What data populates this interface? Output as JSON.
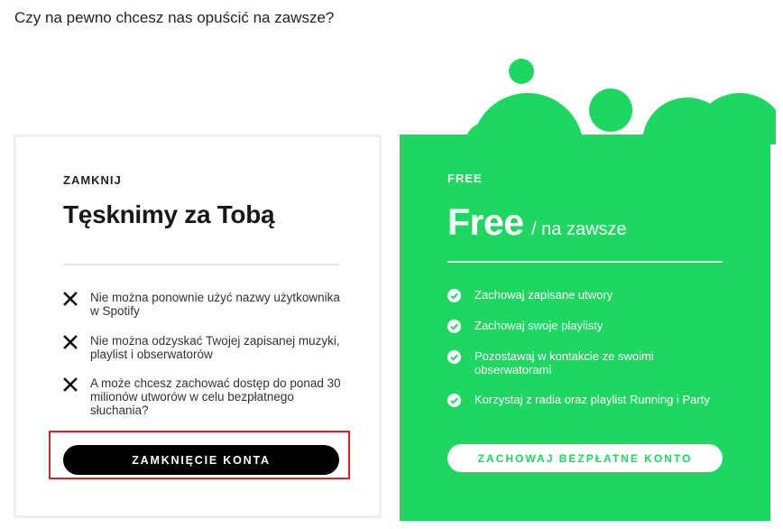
{
  "page": {
    "question": "Czy na pewno chcesz nas opuścić na zawsze?"
  },
  "close_card": {
    "kicker": "ZAMKNIJ",
    "heading": "Tęsknimy za Tobą",
    "items": [
      {
        "icon": "x-icon",
        "text": "Nie można ponownie użyć nazwy użytkownika w Spotify"
      },
      {
        "icon": "x-icon",
        "text": "Nie można odzyskać Twojej zapisanej muzyki, playlist i obserwatorów"
      },
      {
        "icon": "x-icon",
        "text": "A może chcesz zachować dostęp do ponad 30 milionów utworów w celu bezpłatnego słuchania?"
      }
    ],
    "button_label": "ZAMKNIĘCIE KONTA"
  },
  "free_card": {
    "kicker": "FREE",
    "plan_name": "Free",
    "plan_suffix": "/ na zawsze",
    "items": [
      {
        "icon": "check-circle-icon",
        "text": "Zachowaj zapisane utwory"
      },
      {
        "icon": "check-circle-icon",
        "text": "Zachowaj swoje playlisty"
      },
      {
        "icon": "check-circle-icon",
        "text": "Pozostawaj w kontakcie ze swoimi obserwatorami"
      },
      {
        "icon": "check-circle-icon",
        "text": "Korzystaj z radia oraz playlist Running i Party"
      }
    ],
    "button_label": "ZACHOWAJ BEZPŁATNE KONTO"
  },
  "colors": {
    "brand_green": "#1ed760",
    "highlight_red": "#d9242f",
    "text_dark": "#222326"
  }
}
